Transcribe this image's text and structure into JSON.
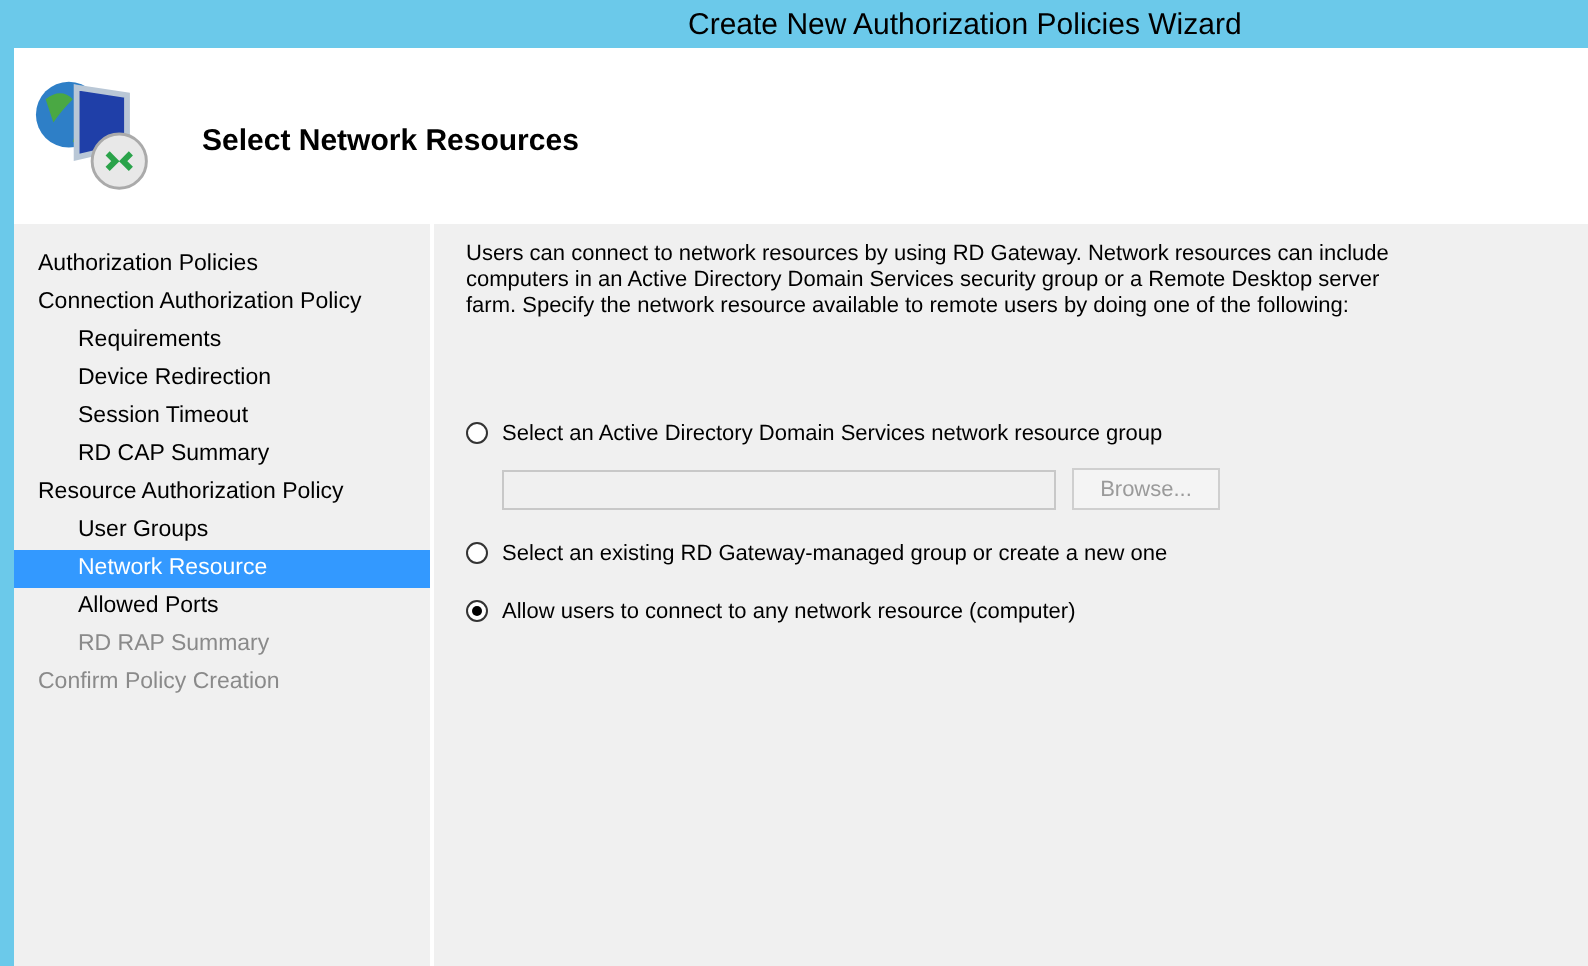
{
  "window": {
    "title": "Create New Authorization Policies Wizard"
  },
  "header": {
    "title": "Select Network Resources"
  },
  "sidebar": {
    "items": [
      {
        "label": "Authorization Policies",
        "selected": false,
        "disabled": false
      },
      {
        "label": "Connection Authorization Policy",
        "selected": false,
        "disabled": false,
        "children": [
          {
            "label": "Requirements",
            "selected": false,
            "disabled": false
          },
          {
            "label": "Device Redirection",
            "selected": false,
            "disabled": false
          },
          {
            "label": "Session Timeout",
            "selected": false,
            "disabled": false
          },
          {
            "label": "RD CAP Summary",
            "selected": false,
            "disabled": false
          }
        ]
      },
      {
        "label": "Resource Authorization Policy",
        "selected": false,
        "disabled": false,
        "children": [
          {
            "label": "User Groups",
            "selected": false,
            "disabled": false
          },
          {
            "label": "Network Resource",
            "selected": true,
            "disabled": false
          },
          {
            "label": "Allowed Ports",
            "selected": false,
            "disabled": false
          },
          {
            "label": "RD RAP Summary",
            "selected": false,
            "disabled": true
          }
        ]
      },
      {
        "label": "Confirm Policy Creation",
        "selected": false,
        "disabled": true
      }
    ]
  },
  "content": {
    "intro": "Users can connect to network resources by using RD Gateway. Network resources can include computers in an Active Directory Domain Services security group or a Remote Desktop server farm. Specify the network resource available to remote users by doing one of the following:",
    "options": [
      {
        "label": "Select an Active Directory Domain Services network resource group",
        "selected": false,
        "field": {
          "disabled": true
        },
        "button": {
          "label": "Browse...",
          "disabled": true
        }
      },
      {
        "label": "Select an existing RD Gateway-managed group or create a new one",
        "selected": false
      },
      {
        "label": "Allow users to connect to any network resource (computer)",
        "selected": true
      }
    ]
  }
}
